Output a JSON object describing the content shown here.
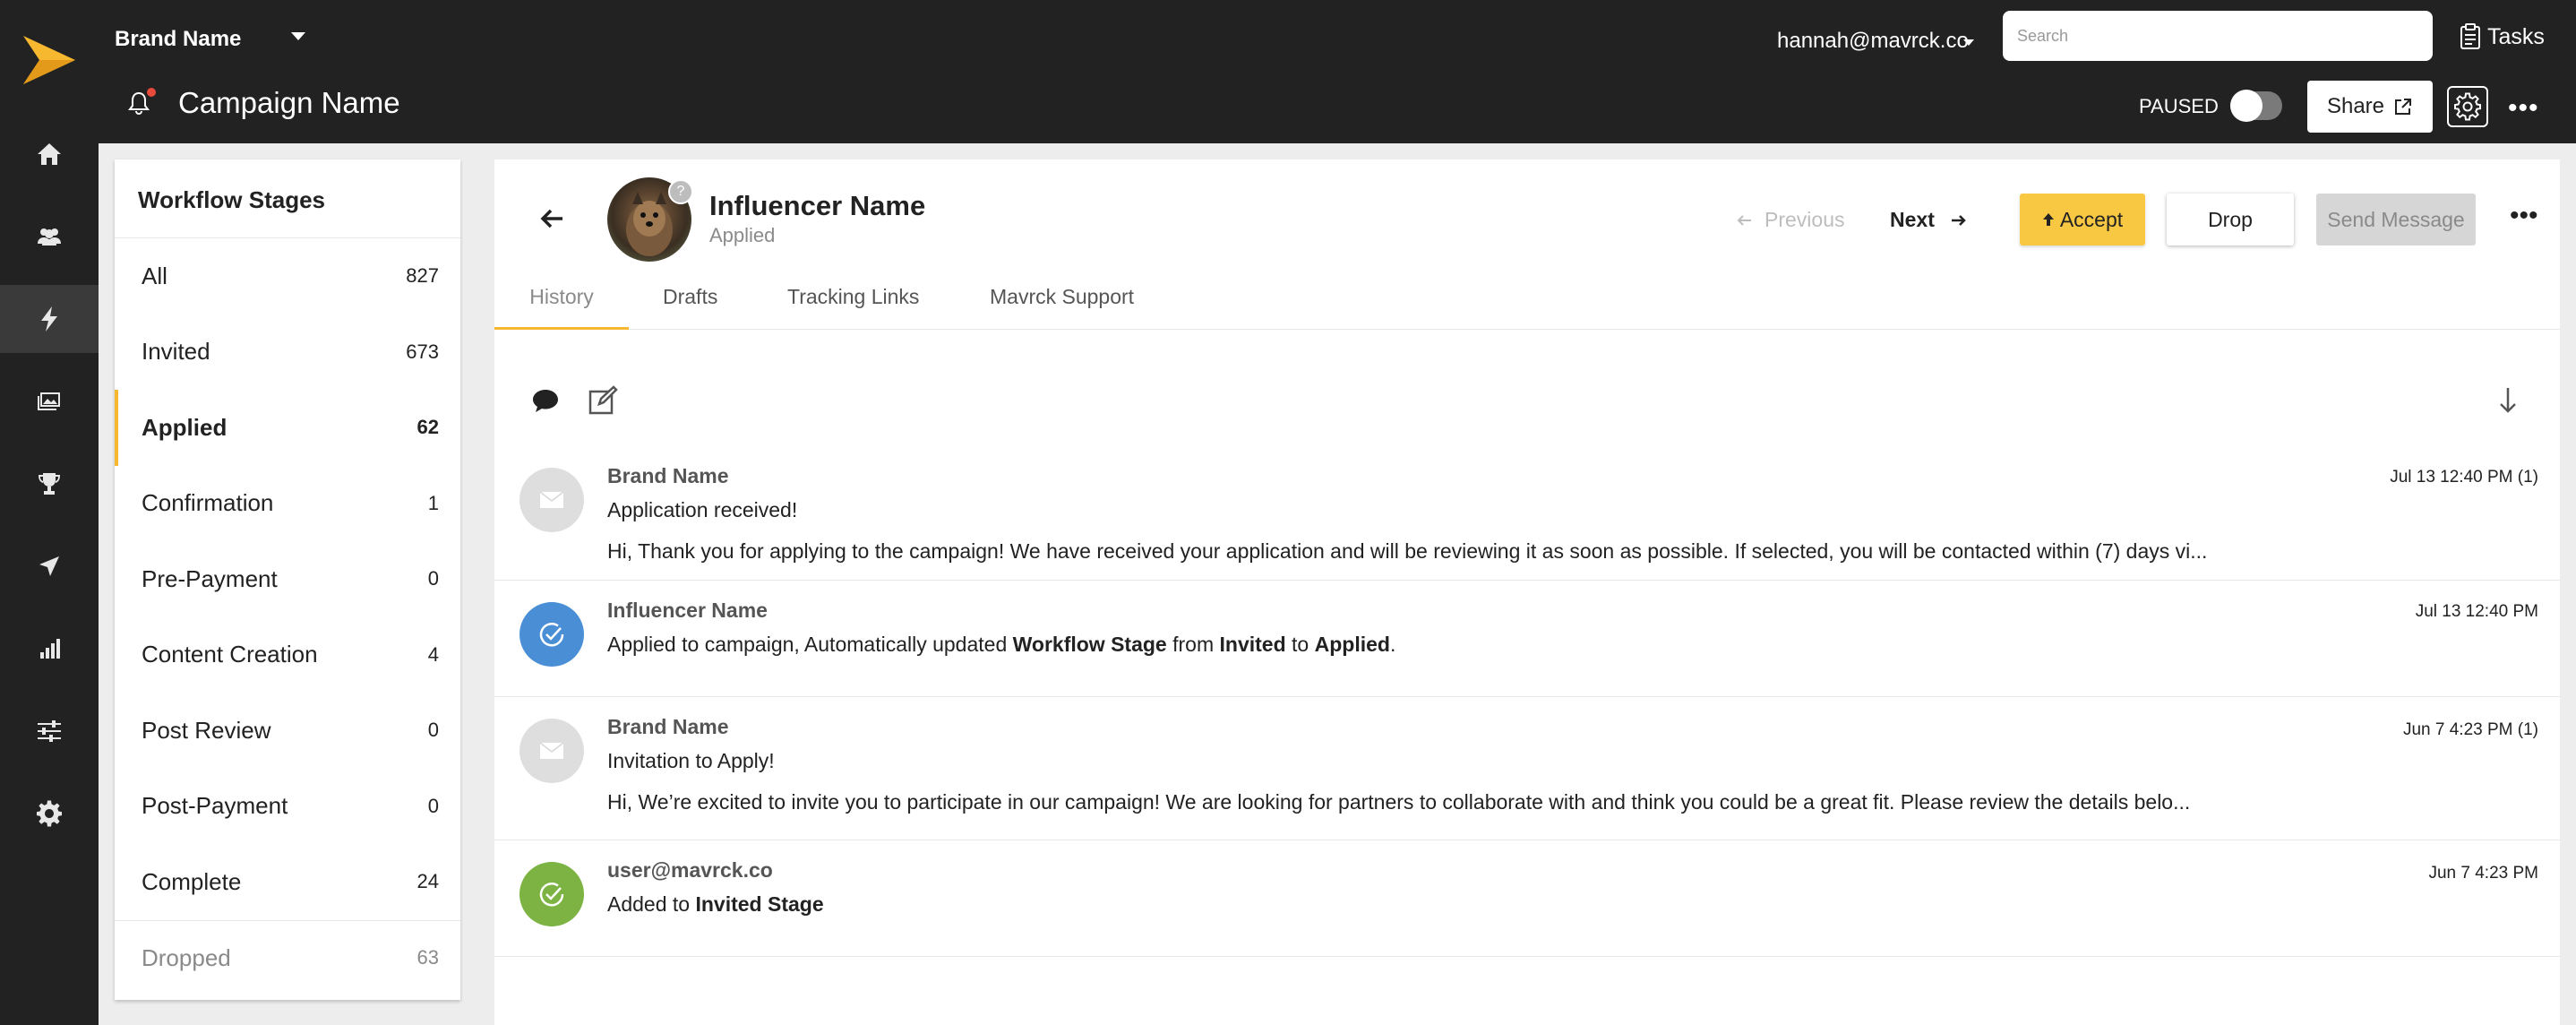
{
  "header": {
    "brand": "Brand Name",
    "campaign": "Campaign Name",
    "user": "hannah@mavrck.co",
    "search_placeholder": "Search",
    "tasks_label": "Tasks",
    "paused_label": "PAUSED",
    "share_label": "Share",
    "more_label": "•••"
  },
  "rail": {
    "items": [
      "home-icon",
      "people-icon",
      "bolt-icon",
      "media-icon",
      "trophy-icon",
      "send-icon",
      "chart-icon",
      "sliders-icon",
      "gear-icon"
    ],
    "active_index": 2
  },
  "stages": {
    "title": "Workflow Stages",
    "items": [
      {
        "label": "All",
        "count": "827"
      },
      {
        "label": "Invited",
        "count": "673"
      },
      {
        "label": "Applied",
        "count": "62"
      },
      {
        "label": "Confirmation",
        "count": "1"
      },
      {
        "label": "Pre-Payment",
        "count": "0"
      },
      {
        "label": "Content Creation",
        "count": "4"
      },
      {
        "label": "Post Review",
        "count": "0"
      },
      {
        "label": "Post-Payment",
        "count": "0"
      },
      {
        "label": "Complete",
        "count": "24"
      },
      {
        "label": "Dropped",
        "count": "63"
      }
    ],
    "active": "Applied"
  },
  "influencer": {
    "name": "Influencer Name",
    "stage": "Applied",
    "badge": "?"
  },
  "actions": {
    "previous": "Previous",
    "next": "Next",
    "accept": "Accept",
    "drop": "Drop",
    "send_message": "Send Message"
  },
  "tabs": [
    "History",
    "Drafts",
    "Tracking Links",
    "Mavrck Support"
  ],
  "history": [
    {
      "author": "Brand Name",
      "time": "Jul 13 12:40 PM (1)",
      "subject": "Application received!",
      "body": "Hi, Thank you for applying to the campaign! We have received your application and will be reviewing it as soon as possible. If selected, you will be contacted within (7) days vi..."
    },
    {
      "author": "Influencer Name",
      "time": "Jul 13 12:40 PM",
      "parts": {
        "a": "Applied to campaign, Automatically updated ",
        "b": "Workflow Stage",
        "c": " from ",
        "d": "Invited",
        "e": " to ",
        "f": "Applied",
        "g": "."
      }
    },
    {
      "author": "Brand Name",
      "time": "Jun 7 4:23 PM (1)",
      "subject": "Invitation to Apply!",
      "body": "Hi, We’re excited to invite you to participate in our campaign! We are looking for partners to collaborate with and think you could be a great fit. Please review the details belo..."
    },
    {
      "author": "user@mavrck.co",
      "time": "Jun 7 4:23 PM",
      "parts": {
        "a": "Added to ",
        "b": "Invited Stage"
      }
    }
  ],
  "colors": {
    "dark": "#222222",
    "accent": "#f5b82e",
    "accept": "#f8c843",
    "blue": "#4a8fd6",
    "green": "#7cb342",
    "mail_grey": "#dedede"
  }
}
